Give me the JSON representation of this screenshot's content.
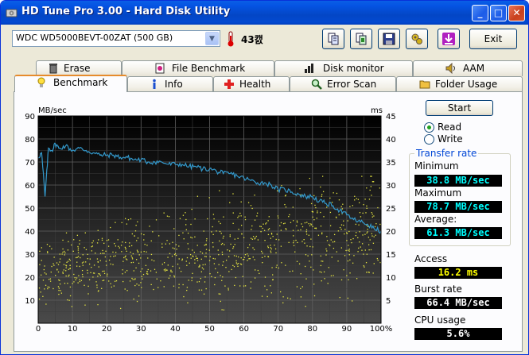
{
  "window": {
    "title": "HD Tune Pro 3.00 - Hard Disk Utility",
    "buttons": {
      "minimize": "_",
      "maximize": "□",
      "close": "✕"
    }
  },
  "toolbar": {
    "drive": "WDC WD5000BEVT-00ZAT (500 GB)",
    "temperature": "43캜",
    "tools": [
      "copy-info-icon",
      "copy-screen-icon",
      "save-icon",
      "options-icon",
      "download-icon"
    ],
    "exit_label": "Exit"
  },
  "tabs_row1": [
    {
      "label": "Erase",
      "icon": "trash-icon"
    },
    {
      "label": "File Benchmark",
      "icon": "file-benchmark-icon"
    },
    {
      "label": "Disk monitor",
      "icon": "disk-monitor-icon"
    },
    {
      "label": "AAM",
      "icon": "speaker-icon"
    }
  ],
  "tabs_row2": [
    {
      "label": "Benchmark",
      "icon": "benchmark-icon",
      "active": true
    },
    {
      "label": "Info",
      "icon": "info-icon"
    },
    {
      "label": "Health",
      "icon": "health-icon"
    },
    {
      "label": "Error Scan",
      "icon": "magnifier-icon"
    },
    {
      "label": "Folder Usage",
      "icon": "folder-icon"
    }
  ],
  "controls": {
    "start_label": "Start",
    "read_label": "Read",
    "write_label": "Write",
    "selected": "Read"
  },
  "transfer_rate": {
    "title": "Transfer rate",
    "minimum_label": "Minimum",
    "minimum": "38.8 MB/sec",
    "maximum_label": "Maximum",
    "maximum": "78.7 MB/sec",
    "average_label": "Average:",
    "average": "61.3 MB/sec"
  },
  "access": {
    "label": "Access",
    "value": "16.2 ms"
  },
  "burst": {
    "label": "Burst rate",
    "value": "66.4 MB/sec"
  },
  "cpu": {
    "label": "CPU usage",
    "value": "5.6%"
  },
  "chart_data": {
    "type": "line",
    "y_left_label": "MB/sec",
    "y_right_label": "ms",
    "x_ticks": [
      "0",
      "10",
      "20",
      "30",
      "40",
      "50",
      "60",
      "70",
      "80",
      "90",
      "100%"
    ],
    "y_left_ticks": [
      10,
      20,
      30,
      40,
      50,
      60,
      70,
      80,
      90
    ],
    "y_right_ticks": [
      5,
      10,
      15,
      20,
      25,
      30,
      35,
      40,
      45
    ],
    "x_range": [
      0,
      100
    ],
    "y_left_range": [
      0,
      90
    ],
    "y_right_range": [
      0,
      45
    ],
    "grid": true,
    "series": [
      {
        "unit": "MB/sec",
        "color": "#3399cc",
        "x": [
          0,
          1,
          2,
          3,
          4,
          5,
          6,
          8,
          10,
          12,
          14,
          16,
          18,
          20,
          22,
          24,
          26,
          28,
          30,
          32,
          34,
          36,
          38,
          40,
          42,
          44,
          46,
          48,
          50,
          52,
          54,
          56,
          58,
          60,
          62,
          64,
          66,
          68,
          70,
          72,
          74,
          76,
          78,
          80,
          82,
          84,
          86,
          88,
          90,
          92,
          94,
          96,
          98,
          100
        ],
        "y": [
          72,
          74,
          55,
          76,
          75,
          78,
          76,
          77,
          75,
          76,
          75,
          74,
          73,
          73,
          73,
          72,
          72,
          71,
          71,
          70,
          70,
          70,
          69,
          69,
          69,
          68,
          68,
          67,
          67,
          66,
          65,
          65,
          64,
          63,
          62,
          61,
          61,
          60,
          58,
          58,
          57,
          56,
          55,
          55,
          53,
          52,
          51,
          49,
          47,
          45,
          44,
          43,
          41,
          40
        ]
      }
    ],
    "access_scatter": {
      "unit": "ms",
      "color": "#e6e640",
      "x_range": [
        0,
        100
      ],
      "y_range_ms": [
        3,
        32
      ],
      "density": "high"
    }
  }
}
